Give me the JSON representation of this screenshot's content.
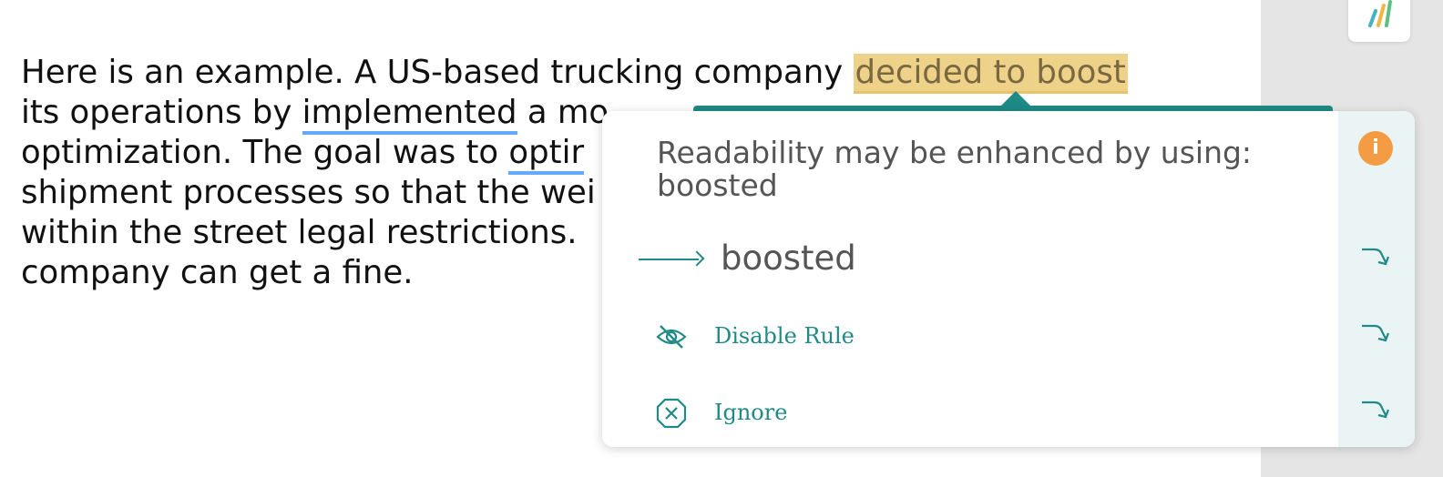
{
  "document": {
    "lines": [
      {
        "before": "Here is an example. A US-based trucking company ",
        "highlight": "decided to boost"
      },
      {
        "a": "its operations by ",
        "under": "implemented",
        "b": " a mo"
      },
      {
        "a": "optimization. The goal was to ",
        "under": "optir"
      },
      {
        "a": "shipment processes so that the wei"
      },
      {
        "a": "within the street legal restrictions."
      },
      {
        "a": "company can get a fine."
      }
    ]
  },
  "popover": {
    "message": "Readability may be enhanced by using: boosted",
    "info_badge": "i",
    "suggestion": "boosted",
    "disable_label": "Disable Rule",
    "ignore_label": "Ignore"
  },
  "colors": {
    "accent": "#1f8a86",
    "highlight": "#efd28a",
    "info": "#f39c44",
    "underline": "#64a8ff"
  },
  "icons": {
    "info": "info-icon",
    "disable": "eye-slash-icon",
    "ignore": "close-octagon-icon",
    "apply": "curved-arrow-icon",
    "logo": "app-logo-icon"
  }
}
